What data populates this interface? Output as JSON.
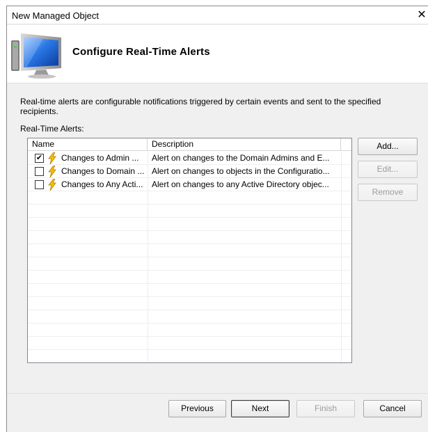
{
  "window": {
    "title": "New Managed Object",
    "close_glyph": "✕"
  },
  "header": {
    "title": "Configure Real-Time Alerts",
    "icon": "computer-monitor-icon"
  },
  "description": "Real-time alerts are configurable notifications triggered by certain events and sent to the specified recipients.",
  "alerts_label": "Real-Time Alerts:",
  "alerts_table": {
    "columns": [
      "Name",
      "Description"
    ],
    "rows": [
      {
        "checked": true,
        "name": "Changes to Admin ...",
        "description": "Alert on changes to the Domain Admins and E...",
        "icon": "lightning-bolt-icon"
      },
      {
        "checked": false,
        "name": "Changes to Domain ...",
        "description": "Alert on changes to objects in the Configuratio...",
        "icon": "lightning-bolt-icon"
      },
      {
        "checked": false,
        "name": "Changes to Any Acti...",
        "description": "Alert on changes to any Active Directory objec...",
        "icon": "lightning-bolt-icon"
      }
    ]
  },
  "side_buttons": {
    "add": "Add...",
    "edit": "Edit...",
    "remove": "Remove"
  },
  "nav_buttons": {
    "previous": "Previous",
    "next": "Next",
    "finish": "Finish",
    "cancel": "Cancel"
  },
  "colors": {
    "bolt_fill": "#f5c400",
    "bolt_stroke": "#b07a00",
    "monitor_blue": "#1d5fd1"
  }
}
